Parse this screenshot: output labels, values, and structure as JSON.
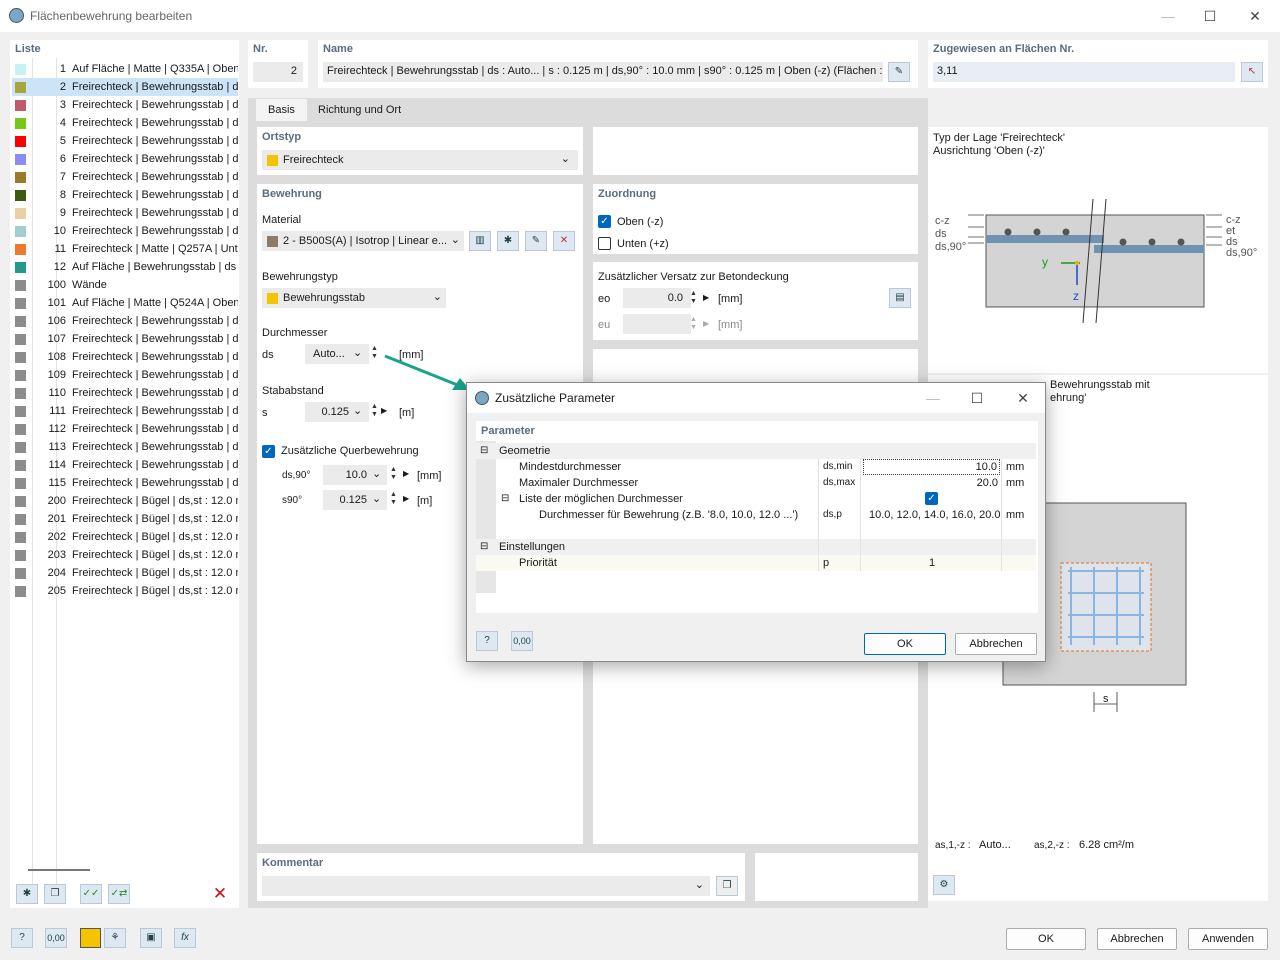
{
  "window": {
    "title": "Flächenbewehrung bearbeiten",
    "btn_min": "—",
    "btn_max": "☐",
    "btn_close": "✕"
  },
  "list": {
    "header": "Liste",
    "items": [
      {
        "num": "1",
        "label": "Auf Fläche | Matte | Q335A | Oben",
        "color": "#c6f2f4"
      },
      {
        "num": "2",
        "label": "Freirechteck | Bewehrungsstab | ds",
        "color": "#a7a63a"
      },
      {
        "num": "3",
        "label": "Freirechteck | Bewehrungsstab | ds",
        "color": "#c05b6b"
      },
      {
        "num": "4",
        "label": "Freirechteck | Bewehrungsstab | ds",
        "color": "#76c818"
      },
      {
        "num": "5",
        "label": "Freirechteck | Bewehrungsstab | ds",
        "color": "#ff0000"
      },
      {
        "num": "6",
        "label": "Freirechteck | Bewehrungsstab | ds",
        "color": "#8c8cf2"
      },
      {
        "num": "7",
        "label": "Freirechteck | Bewehrungsstab | ds",
        "color": "#9b7a2c"
      },
      {
        "num": "8",
        "label": "Freirechteck | Bewehrungsstab | ds",
        "color": "#3d5a12"
      },
      {
        "num": "9",
        "label": "Freirechteck | Bewehrungsstab | ds",
        "color": "#ecd0a4"
      },
      {
        "num": "10",
        "label": "Freirechteck | Bewehrungsstab | ds",
        "color": "#9fd0cf"
      },
      {
        "num": "11",
        "label": "Freirechteck | Matte | Q257A | Unte",
        "color": "#ee7b2d"
      },
      {
        "num": "12",
        "label": "Auf Fläche | Bewehrungsstab | ds :",
        "color": "#229a8b"
      },
      {
        "num": "100",
        "label": "Wände",
        "color": "#8c8c8c"
      },
      {
        "num": "101",
        "label": "Auf Fläche | Matte | Q524A | Oben",
        "color": "#8c8c8c"
      },
      {
        "num": "106",
        "label": "Freirechteck | Bewehrungsstab | ds",
        "color": "#8c8c8c"
      },
      {
        "num": "107",
        "label": "Freirechteck | Bewehrungsstab | ds",
        "color": "#8c8c8c"
      },
      {
        "num": "108",
        "label": "Freirechteck | Bewehrungsstab | ds",
        "color": "#8c8c8c"
      },
      {
        "num": "109",
        "label": "Freirechteck | Bewehrungsstab | ds",
        "color": "#8c8c8c"
      },
      {
        "num": "110",
        "label": "Freirechteck | Bewehrungsstab | ds",
        "color": "#8c8c8c"
      },
      {
        "num": "111",
        "label": "Freirechteck | Bewehrungsstab | ds",
        "color": "#8c8c8c"
      },
      {
        "num": "112",
        "label": "Freirechteck | Bewehrungsstab | ds",
        "color": "#8c8c8c"
      },
      {
        "num": "113",
        "label": "Freirechteck | Bewehrungsstab | ds",
        "color": "#8c8c8c"
      },
      {
        "num": "114",
        "label": "Freirechteck | Bewehrungsstab | ds",
        "color": "#8c8c8c"
      },
      {
        "num": "115",
        "label": "Freirechteck | Bewehrungsstab | ds",
        "color": "#8c8c8c"
      },
      {
        "num": "200",
        "label": "Freirechteck | Bügel | ds,st : 12.0 mm",
        "color": "#8c8c8c"
      },
      {
        "num": "201",
        "label": "Freirechteck | Bügel | ds,st : 12.0 mm",
        "color": "#8c8c8c"
      },
      {
        "num": "202",
        "label": "Freirechteck | Bügel | ds,st : 12.0 mm",
        "color": "#8c8c8c"
      },
      {
        "num": "203",
        "label": "Freirechteck | Bügel | ds,st : 12.0 mm",
        "color": "#8c8c8c"
      },
      {
        "num": "204",
        "label": "Freirechteck | Bügel | ds,st : 12.0 mm",
        "color": "#8c8c8c"
      },
      {
        "num": "205",
        "label": "Freirechteck | Bügel | ds,st : 12.0 mm",
        "color": "#8c8c8c"
      }
    ]
  },
  "nr": {
    "header": "Nr.",
    "value": "2"
  },
  "name": {
    "header": "Name",
    "value": "Freirechteck | Bewehrungsstab | ds : Auto... | s : 0.125 m | ds,90° : 10.0 mm | s90° : 0.125 m | Oben (-z) (Flächen :"
  },
  "assigned": {
    "header": "Zugewiesen an Flächen Nr.",
    "value": "3,11"
  },
  "tabs": [
    "Basis",
    "Richtung und Ort"
  ],
  "ortstyp": {
    "header": "Ortstyp",
    "value": "Freirechteck"
  },
  "bewehrung": {
    "header": "Bewehrung",
    "material_label": "Material",
    "material_value": "2 - B500S(A) | Isotrop | Linear e...",
    "type_label": "Bewehrungstyp",
    "type_value": "Bewehrungsstab",
    "diam_label": "Durchmesser",
    "ds_symbol": "ds",
    "ds_value": "Auto...",
    "ds_unit": "[mm]",
    "spacing_label": "Stababstand",
    "s_symbol": "s",
    "s_value": "0.125",
    "s_unit": "[m]",
    "quer_label": "Zusätzliche Querbewehrung",
    "ds90_symbol": "ds,90°",
    "ds90_value": "10.0",
    "ds90_unit": "[mm]",
    "s90_symbol": "s90°",
    "s90_value": "0.125",
    "s90_unit": "[m]"
  },
  "zuordnung": {
    "header": "Zuordnung",
    "oben": "Oben (-z)",
    "unten": "Unten (+z)"
  },
  "versatz": {
    "header": "Zusätzlicher Versatz zur Betondeckung",
    "eo_symbol": "eo",
    "eo_value": "0.0",
    "eo_unit": "[mm]",
    "eu_symbol": "eu",
    "eu_unit": "[mm]"
  },
  "preview": {
    "line1": "Typ der Lage 'Freirechteck'",
    "line2": "Ausrichtung 'Oben (-z)'",
    "caption_a": "Bewehrungsstab mit",
    "caption_b": "ehrung'",
    "labels_left": [
      "c-z",
      "ds",
      "ds,90°"
    ],
    "labels_right": [
      "c-z",
      "et",
      "ds",
      "ds,90°"
    ],
    "axis_y": "y",
    "axis_z": "z",
    "dim_s": "s",
    "as1_label": "as,1,-z :",
    "as1_value": "Auto...",
    "as2_label": "as,2,-z :",
    "as2_value": "6.28 cm²/m"
  },
  "kommentar": {
    "header": "Kommentar"
  },
  "dialog": {
    "title": "Zusätzliche Parameter",
    "section": "Parameter",
    "g_geometrie": "Geometrie",
    "r1_label": "Mindestdurchmesser",
    "r1_sym": "ds,min",
    "r1_val": "10.0",
    "r1_unit": "mm",
    "r2_label": "Maximaler Durchmesser",
    "r2_sym": "ds,max",
    "r2_val": "20.0",
    "r2_unit": "mm",
    "r3_label": "Liste der möglichen Durchmesser",
    "r4_label": "Durchmesser für Bewehrung (z.B. '8.0, 10.0, 12.0 ...')",
    "r4_sym": "ds,p",
    "r4_val": "10.0, 12.0, 14.0, 16.0, 20.0",
    "r4_unit": "mm",
    "g_einstellungen": "Einstellungen",
    "r5_label": "Priorität",
    "r5_sym": "p",
    "r5_val": "1",
    "ok": "OK",
    "cancel": "Abbrechen"
  },
  "footer": {
    "ok": "OK",
    "cancel": "Abbrechen",
    "apply": "Anwenden"
  }
}
